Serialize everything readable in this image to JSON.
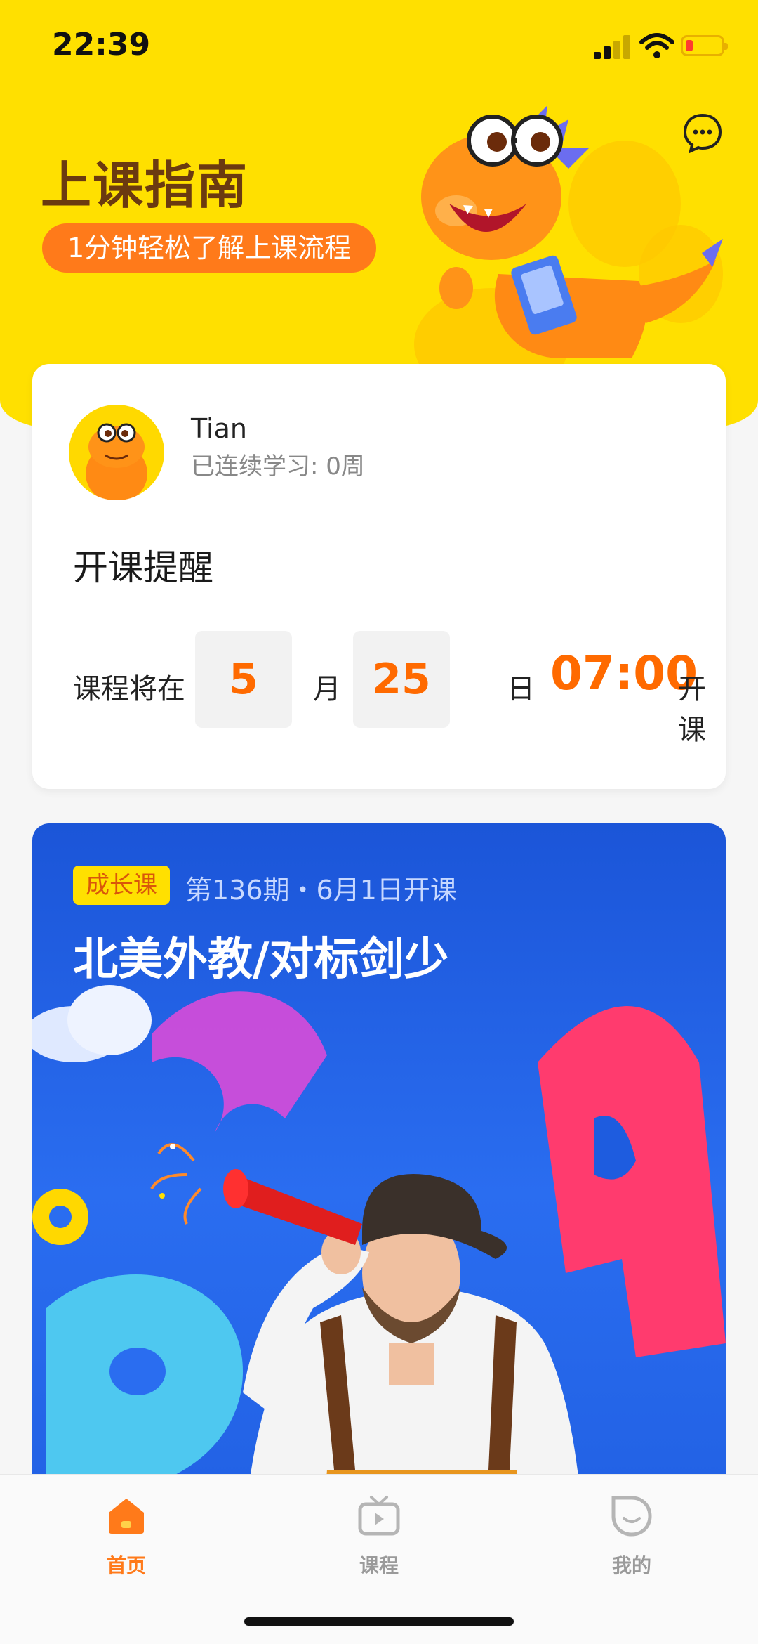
{
  "status_bar": {
    "time": "22:39"
  },
  "header": {
    "title": "上课指南",
    "subtitle": "1分钟轻松了解上课流程",
    "colors": {
      "background": "#ffe000",
      "title": "#6b3a10",
      "pill": "#ff7a1a"
    }
  },
  "profile": {
    "name": "Tian",
    "streak": "已连续学习: 0周"
  },
  "reminder": {
    "title": "开课提醒",
    "prefix": "课程将在",
    "month": "5",
    "month_unit": "月",
    "day": "25",
    "day_unit": "日",
    "time": "07:00",
    "suffix": "开课",
    "accent": "#ff6a00"
  },
  "promo": {
    "tag": "成长课",
    "period": "第136期・6月1日开课",
    "title": "北美外教/对标剑少"
  },
  "tabbar": {
    "items": [
      {
        "label": "首页",
        "icon": "home-icon",
        "active": true
      },
      {
        "label": "课程",
        "icon": "tv-icon",
        "active": false
      },
      {
        "label": "我的",
        "icon": "profile-face-icon",
        "active": false
      }
    ],
    "active_color": "#ff7a1a",
    "inactive_color": "#9a9a9a"
  }
}
